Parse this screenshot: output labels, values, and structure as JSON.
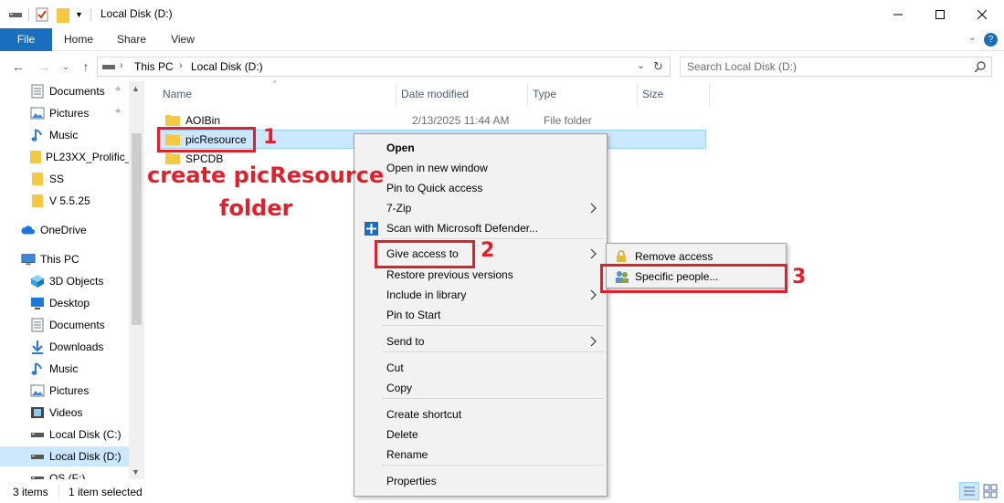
{
  "window": {
    "title": "Local Disk (D:)"
  },
  "ribbon": {
    "tabs": [
      "File",
      "Home",
      "Share",
      "View"
    ]
  },
  "address": {
    "path": [
      "This PC",
      "Local Disk (D:)"
    ],
    "search_placeholder": "Search Local Disk (D:)"
  },
  "nav": {
    "items": [
      {
        "label": "Documents",
        "icon": "documents-icon",
        "pinned": true
      },
      {
        "label": "Pictures",
        "icon": "pictures-icon",
        "pinned": true
      },
      {
        "label": "Music",
        "icon": "music-icon",
        "pinned": false
      },
      {
        "label": "PL23XX_Prolific_",
        "icon": "folder-icon",
        "pinned": false
      },
      {
        "label": "SS",
        "icon": "folder-icon",
        "pinned": false
      },
      {
        "label": "V 5.5.25",
        "icon": "folder-icon",
        "pinned": false
      },
      {
        "label": "OneDrive",
        "icon": "cloud-icon",
        "pinned": false
      },
      {
        "label": "This PC",
        "icon": "computer-icon",
        "pinned": false
      },
      {
        "label": "3D Objects",
        "icon": "3d-objects-icon",
        "pinned": false
      },
      {
        "label": "Desktop",
        "icon": "desktop-icon",
        "pinned": false
      },
      {
        "label": "Documents",
        "icon": "documents-icon",
        "pinned": false
      },
      {
        "label": "Downloads",
        "icon": "downloads-icon",
        "pinned": false
      },
      {
        "label": "Music",
        "icon": "music-icon",
        "pinned": false
      },
      {
        "label": "Pictures",
        "icon": "pictures-icon",
        "pinned": false
      },
      {
        "label": "Videos",
        "icon": "videos-icon",
        "pinned": false
      },
      {
        "label": "Local Disk (C:)",
        "icon": "drive-icon",
        "pinned": false
      },
      {
        "label": "Local Disk (D:)",
        "icon": "drive-icon",
        "pinned": false,
        "selected": true
      },
      {
        "label": "OS (F:)",
        "icon": "drive-icon",
        "pinned": false
      }
    ]
  },
  "columns": {
    "name": "Name",
    "date": "Date modified",
    "type": "Type",
    "size": "Size"
  },
  "files": [
    {
      "name": "AOIBin",
      "date": "2/13/2025 11:44 AM",
      "type": "File folder"
    },
    {
      "name": "picResource",
      "date": "",
      "type": "",
      "selected": true
    },
    {
      "name": "SPCDB",
      "date": "",
      "type": ""
    }
  ],
  "status": {
    "count": "3 items",
    "selected": "1 item selected"
  },
  "context_menu": {
    "items": [
      {
        "label": "Open",
        "bold": true
      },
      {
        "label": "Open in new window"
      },
      {
        "label": "Pin to Quick access"
      },
      {
        "label": "7-Zip",
        "submenu": true
      },
      {
        "label": "Scan with Microsoft Defender...",
        "icon": "defender-icon"
      },
      {
        "label": "Give access to",
        "submenu": true
      },
      {
        "label": "Restore previous versions"
      },
      {
        "label": "Include in library",
        "submenu": true
      },
      {
        "label": "Pin to Start"
      },
      {
        "label": "Send to",
        "submenu": true
      },
      {
        "label": "Cut"
      },
      {
        "label": "Copy"
      },
      {
        "label": "Create shortcut"
      },
      {
        "label": "Delete"
      },
      {
        "label": "Rename"
      },
      {
        "label": "Properties"
      }
    ]
  },
  "submenu": {
    "items": [
      {
        "label": "Remove access",
        "icon": "lock-icon"
      },
      {
        "label": "Specific people...",
        "icon": "people-icon"
      }
    ]
  },
  "annotations": {
    "step1": "1",
    "step2": "2",
    "step3": "3",
    "caption_line1": "create picResource",
    "caption_line2": "folder"
  },
  "colors": {
    "accent": "#1a6ebf",
    "selection": "#cce8ff",
    "annotation_red": "#e0202a",
    "folder_yellow": "#f4c842"
  }
}
